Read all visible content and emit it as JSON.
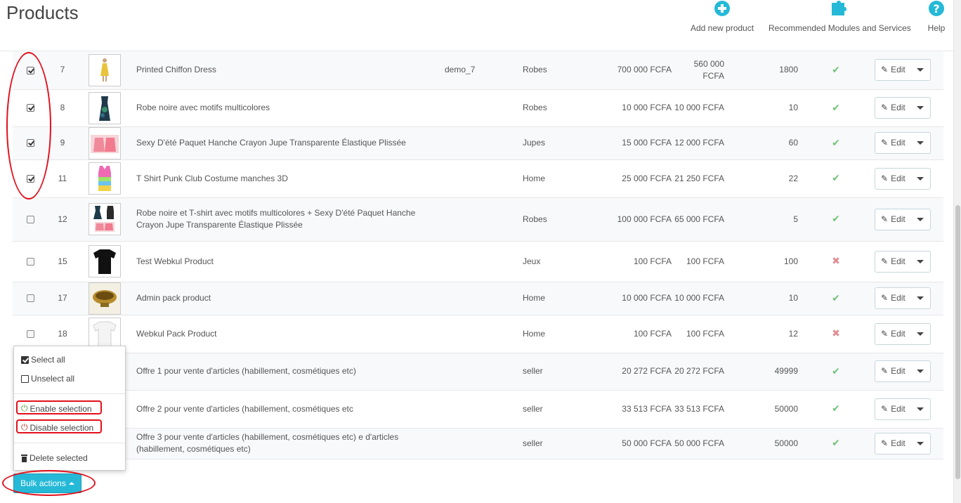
{
  "header": {
    "title": "Products",
    "toolbar": [
      {
        "label": "Add new product",
        "icon": "plus-circle-icon"
      },
      {
        "label": "Recommended Modules and Services",
        "icon": "puzzle-icon"
      },
      {
        "label": "Help",
        "icon": "help-circle-icon"
      }
    ]
  },
  "colors": {
    "accent": "#25b9d7",
    "enabled": "#72c279",
    "disabled": "#e08f95",
    "annotation": "#e3101c"
  },
  "products": [
    {
      "checked": true,
      "id": "7",
      "name": "Printed Chiffon Dress",
      "reference": "demo_7",
      "category": "Robes",
      "base_price": "700 000 FCFA",
      "final_price": "560 000 FCFA",
      "quantity": "1800",
      "status": "enabled",
      "thumb": "dress-yellow"
    },
    {
      "checked": true,
      "id": "8",
      "name": "Robe noire avec motifs multicolores",
      "reference": "",
      "category": "Robes",
      "base_price": "10 000 FCFA",
      "final_price": "10 000 FCFA",
      "quantity": "10",
      "status": "enabled",
      "thumb": "dress-dark"
    },
    {
      "checked": true,
      "id": "9",
      "name": "Sexy D'été Paquet Hanche Crayon Jupe Transparente Élastique Plissée",
      "reference": "",
      "category": "Jupes",
      "base_price": "15 000 FCFA",
      "final_price": "12 000 FCFA",
      "quantity": "60",
      "status": "enabled",
      "thumb": "skirt-pink"
    },
    {
      "checked": true,
      "id": "11",
      "name": "T Shirt Punk Club Costume manches 3D",
      "reference": "",
      "category": "Home",
      "base_price": "25 000 FCFA",
      "final_price": "21 250 FCFA",
      "quantity": "22",
      "status": "enabled",
      "thumb": "tank-rainbow"
    },
    {
      "checked": false,
      "id": "12",
      "name": "Robe noire et T-shirt avec motifs multicolores + Sexy D'été Paquet Hanche Crayon Jupe Transparente Élastique Plissée",
      "reference": "",
      "category": "Robes",
      "base_price": "100 000 FCFA",
      "final_price": "65 000 FCFA",
      "quantity": "5",
      "status": "enabled",
      "thumb": "combo"
    },
    {
      "checked": false,
      "id": "15",
      "name": "Test Webkul Product",
      "reference": "",
      "category": "Jeux",
      "base_price": "100 FCFA",
      "final_price": "100 FCFA",
      "quantity": "100",
      "status": "disabled",
      "thumb": "tshirt-black"
    },
    {
      "checked": false,
      "id": "17",
      "name": "Admin pack product",
      "reference": "",
      "category": "Home",
      "base_price": "10 000 FCFA",
      "final_price": "10 000 FCFA",
      "quantity": "10",
      "status": "enabled",
      "thumb": "bowl"
    },
    {
      "checked": false,
      "id": "18",
      "name": "Webkul Pack Product",
      "reference": "",
      "category": "Home",
      "base_price": "100 FCFA",
      "final_price": "100 FCFA",
      "quantity": "12",
      "status": "disabled",
      "thumb": "tshirt-white"
    },
    {
      "checked": false,
      "id": "",
      "name": "Offre 1 pour vente d'articles (habillement, cosmétiques etc)",
      "reference": "",
      "category": "seller",
      "base_price": "20 272 FCFA",
      "final_price": "20 272 FCFA",
      "quantity": "49999",
      "status": "enabled",
      "thumb": ""
    },
    {
      "checked": false,
      "id": "",
      "name": "Offre 2 pour vente d'articles (habillement, cosmétiques etc",
      "reference": "",
      "category": "seller",
      "base_price": "33 513 FCFA",
      "final_price": "33 513 FCFA",
      "quantity": "50000",
      "status": "enabled",
      "thumb": ""
    },
    {
      "checked": false,
      "id": "",
      "name": "Offre 3 pour vente d'articles (habillement, cosmétiques etc) e d'articles (habillement, cosmétiques etc)",
      "reference": "",
      "category": "seller",
      "base_price": "50 000 FCFA",
      "final_price": "50 000 FCFA",
      "quantity": "50000",
      "status": "enabled",
      "thumb": ""
    }
  ],
  "row_actions": {
    "edit_label": "Edit"
  },
  "bulk_menu": {
    "select_all": "Select all",
    "unselect_all": "Unselect all",
    "enable_selection": "Enable selection",
    "disable_selection": "Disable selection",
    "delete_selected": "Delete selected"
  },
  "bulk_button": {
    "label": "Bulk actions"
  }
}
